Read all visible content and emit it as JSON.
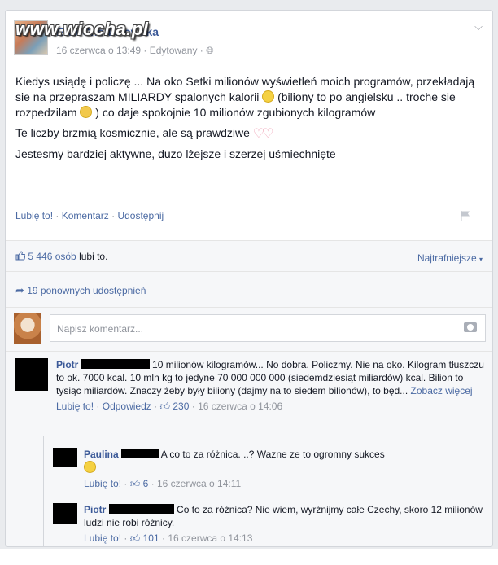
{
  "watermark": "www.wiocha.pl",
  "post": {
    "author": "Ewa Chodakowska",
    "date": "16 czerwca o 13:49",
    "edited": "Edytowany",
    "paragraphs": {
      "p1a": "Kiedys usiądę i policzę ... Na oko Setki milionów wyświetleń moich programów, przekładają sie na przepraszam MILIARDY spalonych kalorii",
      "p1b": "(biliony to po angielsku .. troche sie rozpedzilam",
      "p1c": ") co daje spokojnie 10 milionów zgubionych kilogramów",
      "p2": "Te liczby brzmią kosmicznie, ale są prawdziwe",
      "p3": "Jestesmy bardziej aktywne, duzo lżejsze i szerzej uśmiechnięte"
    },
    "actions": {
      "like": "Lubię to!",
      "comment": "Komentarz",
      "share": "Udostępnij"
    }
  },
  "likes": {
    "count": "5 446 osób",
    "suffix": "lubi to.",
    "sort": "Najtrafniejsze"
  },
  "shares": {
    "text": "19 ponownych udostępnień"
  },
  "composer": {
    "placeholder": "Napisz komentarz..."
  },
  "comments": [
    {
      "name": "Piotr",
      "text": "10 milionów kilogramów... No dobra. Policzmy. Nie na oko. Kilogram tłuszczu to ok. 7000 kcal. 10 mln kg to jedyne 70 000 000 000 (siedemdziesiąt miliardów) kcal. Bilion to tysiąc miliardów. Znaczy żeby były biliony (dajmy na to siedem bilionów), to będ...",
      "more": "Zobacz więcej",
      "like": "Lubię to!",
      "reply": "Odpowiedz",
      "likes": "230",
      "date": "16 czerwca o 14:06"
    },
    {
      "name": "Paulina",
      "text": "A co to za różnica. ..? Wazne ze to ogromny sukces",
      "like": "Lubię to!",
      "likes": "6",
      "date": "16 czerwca o 14:11"
    },
    {
      "name": "Piotr",
      "text": "Co to za różnica? Nie wiem, wyrżnijmy całe Czechy, skoro 12 milionów ludzi nie robi różnicy.",
      "like": "Lubię to!",
      "likes": "101",
      "date": "16 czerwca o 14:13"
    }
  ],
  "colors": {
    "link": "#3b5998",
    "muted": "#90949c",
    "panel": "#f6f7f9"
  }
}
